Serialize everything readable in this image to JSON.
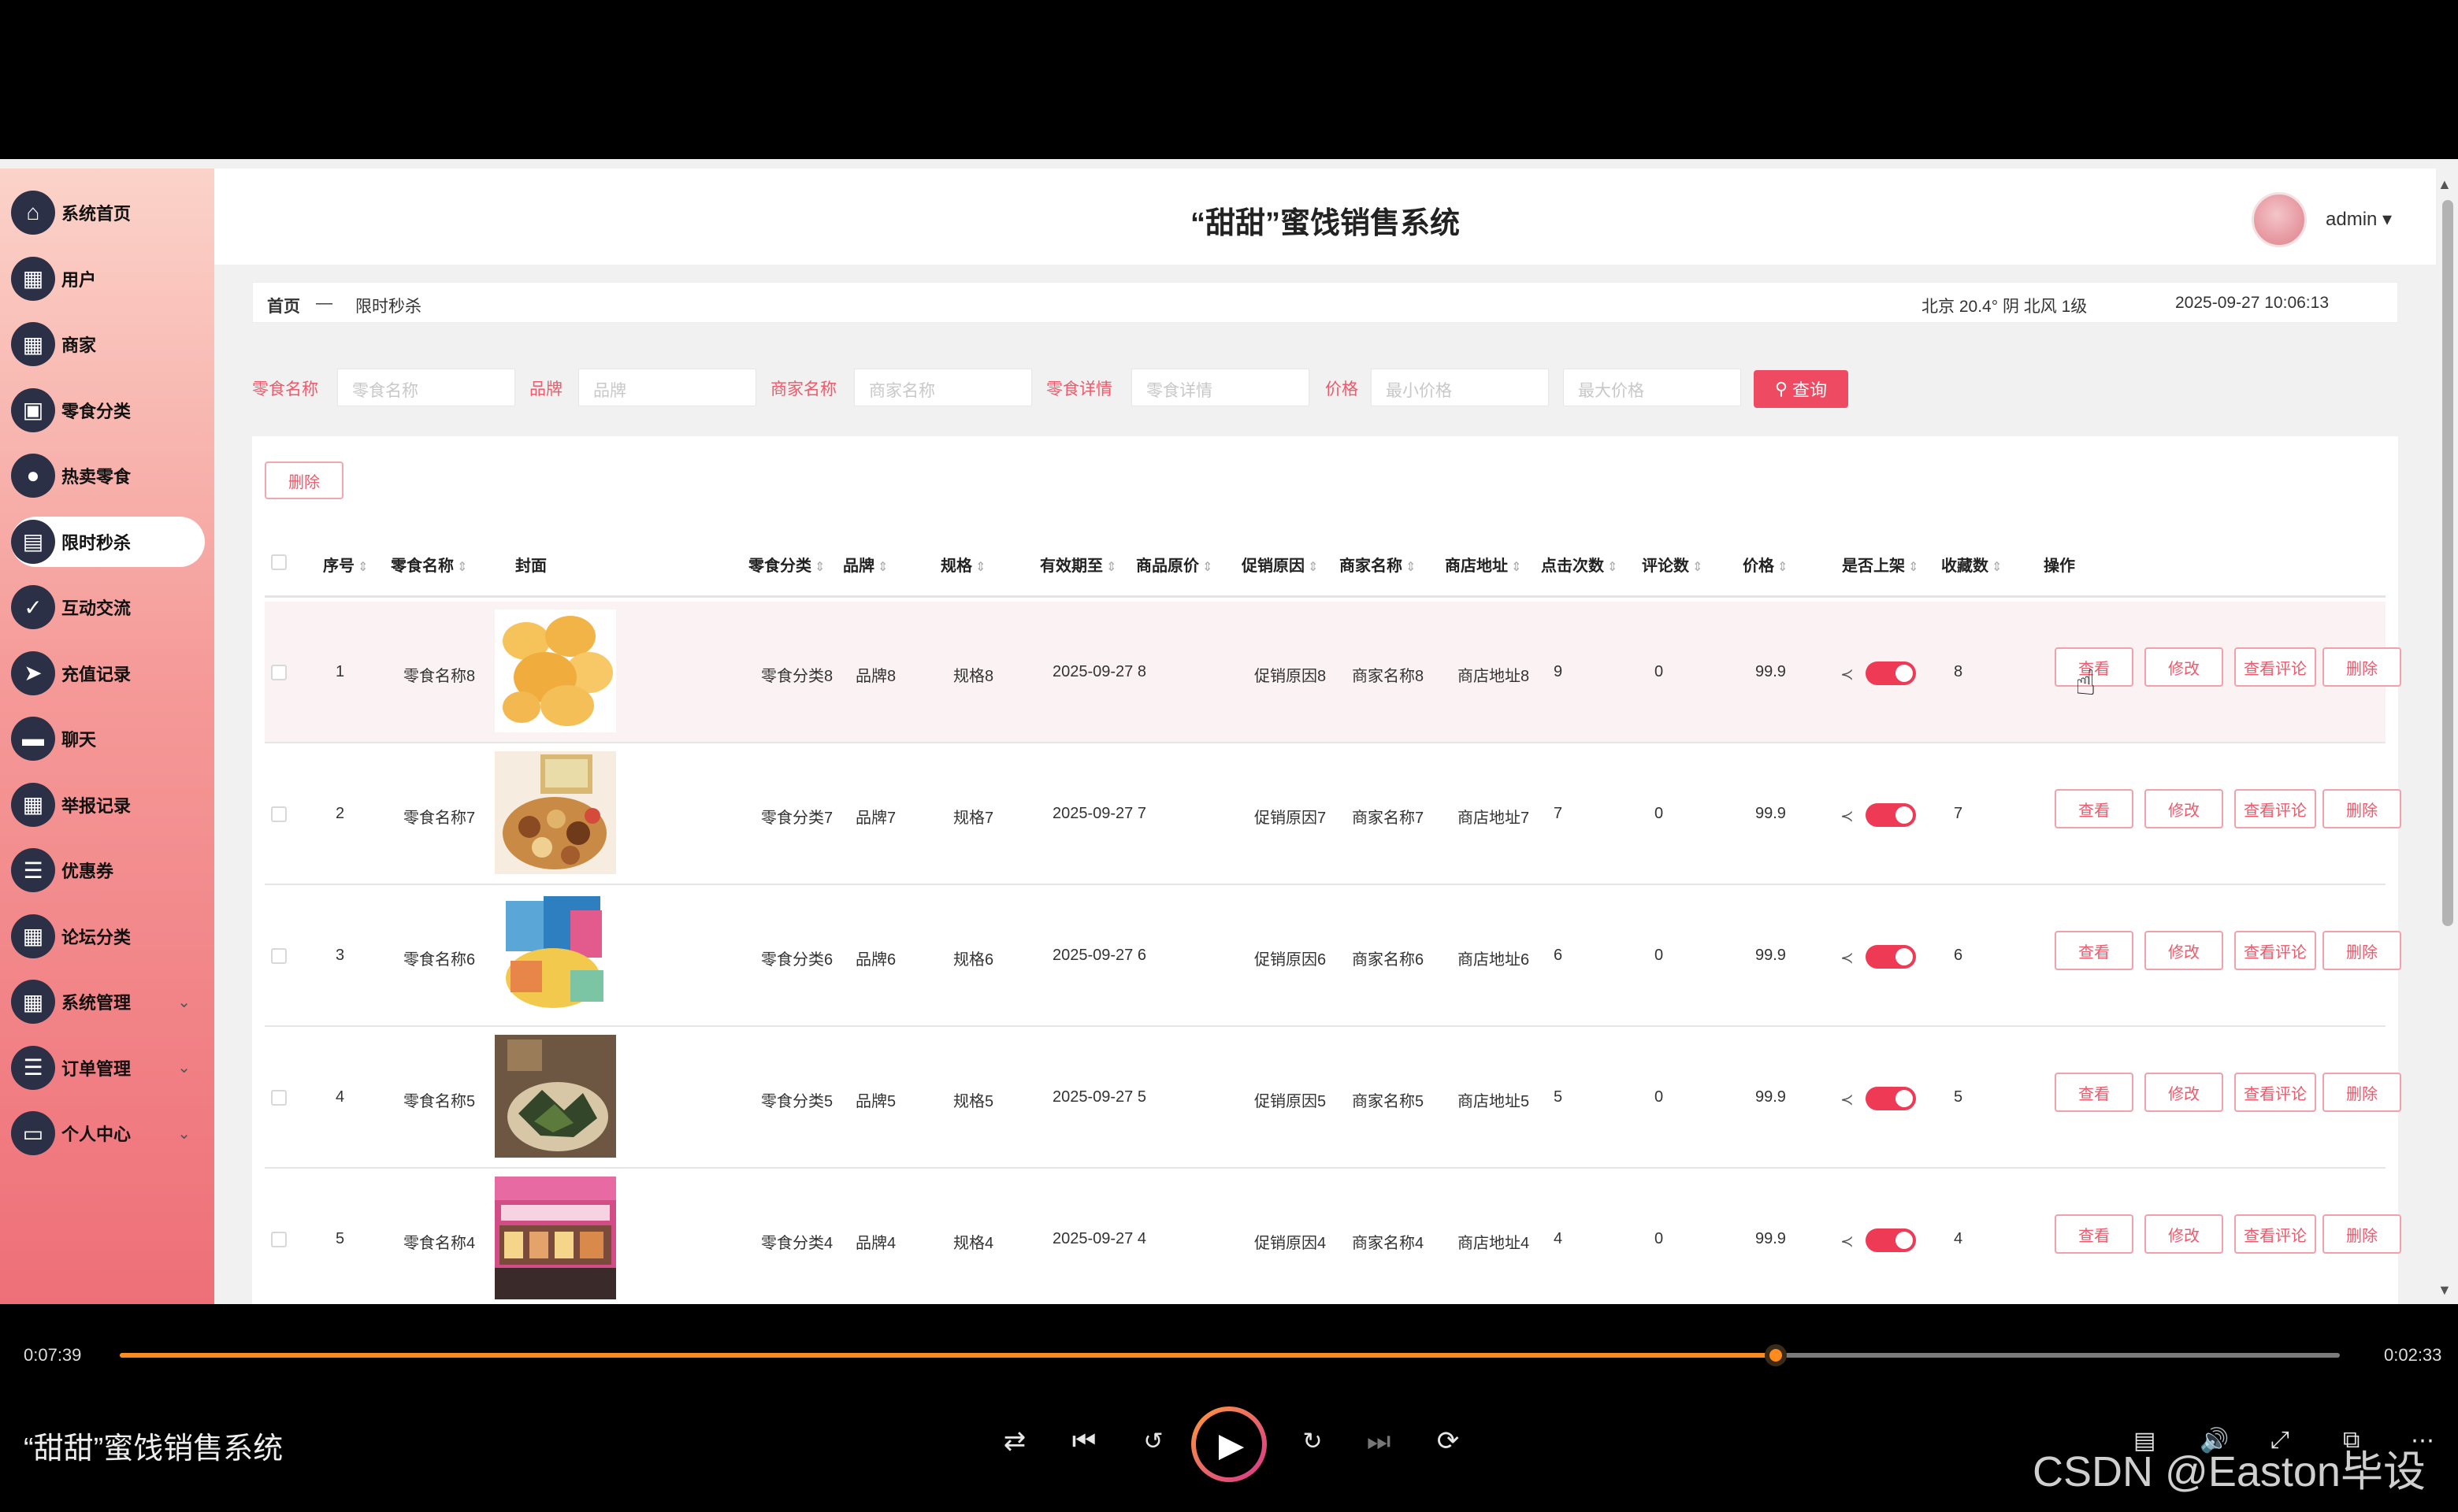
{
  "app": {
    "title": "“甜甜”蜜饯销售系统",
    "user": "admin",
    "user_caret": "▾"
  },
  "sidebar": {
    "items": [
      {
        "label": "系统首页",
        "icon": "⌂",
        "expand": ""
      },
      {
        "label": "用户",
        "icon": "▦",
        "expand": ""
      },
      {
        "label": "商家",
        "icon": "▦",
        "expand": ""
      },
      {
        "label": "零食分类",
        "icon": "▣",
        "expand": ""
      },
      {
        "label": "热卖零食",
        "icon": "●",
        "expand": ""
      },
      {
        "label": "限时秒杀",
        "icon": "▤",
        "expand": "",
        "active": true
      },
      {
        "label": "互动交流",
        "icon": "✓",
        "expand": ""
      },
      {
        "label": "充值记录",
        "icon": "➤",
        "expand": ""
      },
      {
        "label": "聊天",
        "icon": "▬",
        "expand": ""
      },
      {
        "label": "举报记录",
        "icon": "▦",
        "expand": ""
      },
      {
        "label": "优惠券",
        "icon": "☰",
        "expand": ""
      },
      {
        "label": "论坛分类",
        "icon": "▦",
        "expand": ""
      },
      {
        "label": "系统管理",
        "icon": "▦",
        "expand": "⌄"
      },
      {
        "label": "订单管理",
        "icon": "☰",
        "expand": "⌄"
      },
      {
        "label": "个人中心",
        "icon": "▭",
        "expand": "⌄"
      }
    ]
  },
  "breadcrumb": {
    "home": "首页",
    "sep": "—",
    "current": "限时秒杀",
    "weather": "北京 20.4° 阴 北风 1级",
    "datetime": "2025-09-27 10:06:13"
  },
  "filters": [
    {
      "label": "零食名称",
      "placeholder": "零食名称"
    },
    {
      "label": "品牌",
      "placeholder": "品牌"
    },
    {
      "label": "商家名称",
      "placeholder": "商家名称"
    },
    {
      "label": "零食详情",
      "placeholder": "零食详情"
    },
    {
      "label": "价格",
      "placeholder": "最小价格"
    },
    {
      "label": "",
      "placeholder": "最大价格"
    }
  ],
  "query_button": "查询",
  "delete_button": "删除",
  "columns": [
    "序号",
    "零食名称",
    "封面",
    "零食分类",
    "品牌",
    "规格",
    "有效期至",
    "商品原价",
    "促销原因",
    "商家名称",
    "商店地址",
    "点击次数",
    "评论数",
    "价格",
    "是否上架",
    "收藏数",
    "操作"
  ],
  "row_actions": [
    "查看",
    "修改",
    "查看评论",
    "删除"
  ],
  "rows": [
    {
      "index": "1",
      "name": "零食名称8",
      "category": "零食分类8",
      "brand": "品牌8",
      "spec": "规格8",
      "expiry": "2025-09-27 8",
      "reason": "促销原因8",
      "merchant": "商家名称8",
      "address": "商店地址8",
      "clicks": "9",
      "comments": "0",
      "price": "99.9",
      "favorites": "8",
      "listed": true,
      "image": "chips"
    },
    {
      "index": "2",
      "name": "零食名称7",
      "category": "零食分类7",
      "brand": "品牌7",
      "spec": "规格7",
      "expiry": "2025-09-27 7",
      "reason": "促销原因7",
      "merchant": "商家名称7",
      "address": "商店地址7",
      "clicks": "7",
      "comments": "0",
      "price": "99.9",
      "favorites": "7",
      "listed": true,
      "image": "nuts"
    },
    {
      "index": "3",
      "name": "零食名称6",
      "category": "零食分类6",
      "brand": "品牌6",
      "spec": "规格6",
      "expiry": "2025-09-27 6",
      "reason": "促销原因6",
      "merchant": "商家名称6",
      "address": "商店地址6",
      "clicks": "6",
      "comments": "0",
      "price": "99.9",
      "favorites": "6",
      "listed": true,
      "image": "snack-pack"
    },
    {
      "index": "4",
      "name": "零食名称5",
      "category": "零食分类5",
      "brand": "品牌5",
      "spec": "规格5",
      "expiry": "2025-09-27 5",
      "reason": "促销原因5",
      "merchant": "商家名称5",
      "address": "商店地址5",
      "clicks": "5",
      "comments": "0",
      "price": "99.9",
      "favorites": "5",
      "listed": true,
      "image": "seaweed"
    },
    {
      "index": "5",
      "name": "零食名称4",
      "category": "零食分类4",
      "brand": "品牌4",
      "spec": "规格4",
      "expiry": "2025-09-27 4",
      "reason": "促销原因4",
      "merchant": "商家名称4",
      "address": "商店地址4",
      "clicks": "4",
      "comments": "0",
      "price": "99.9",
      "favorites": "4",
      "listed": true,
      "image": "shop"
    }
  ],
  "player": {
    "elapsed": "0:07:39",
    "remaining": "0:02:33",
    "progress": 0.746,
    "title": "“甜甜”蜜饯销售系统",
    "accent": "#ff8a1e"
  },
  "watermark": "CSDN @Easton毕设"
}
